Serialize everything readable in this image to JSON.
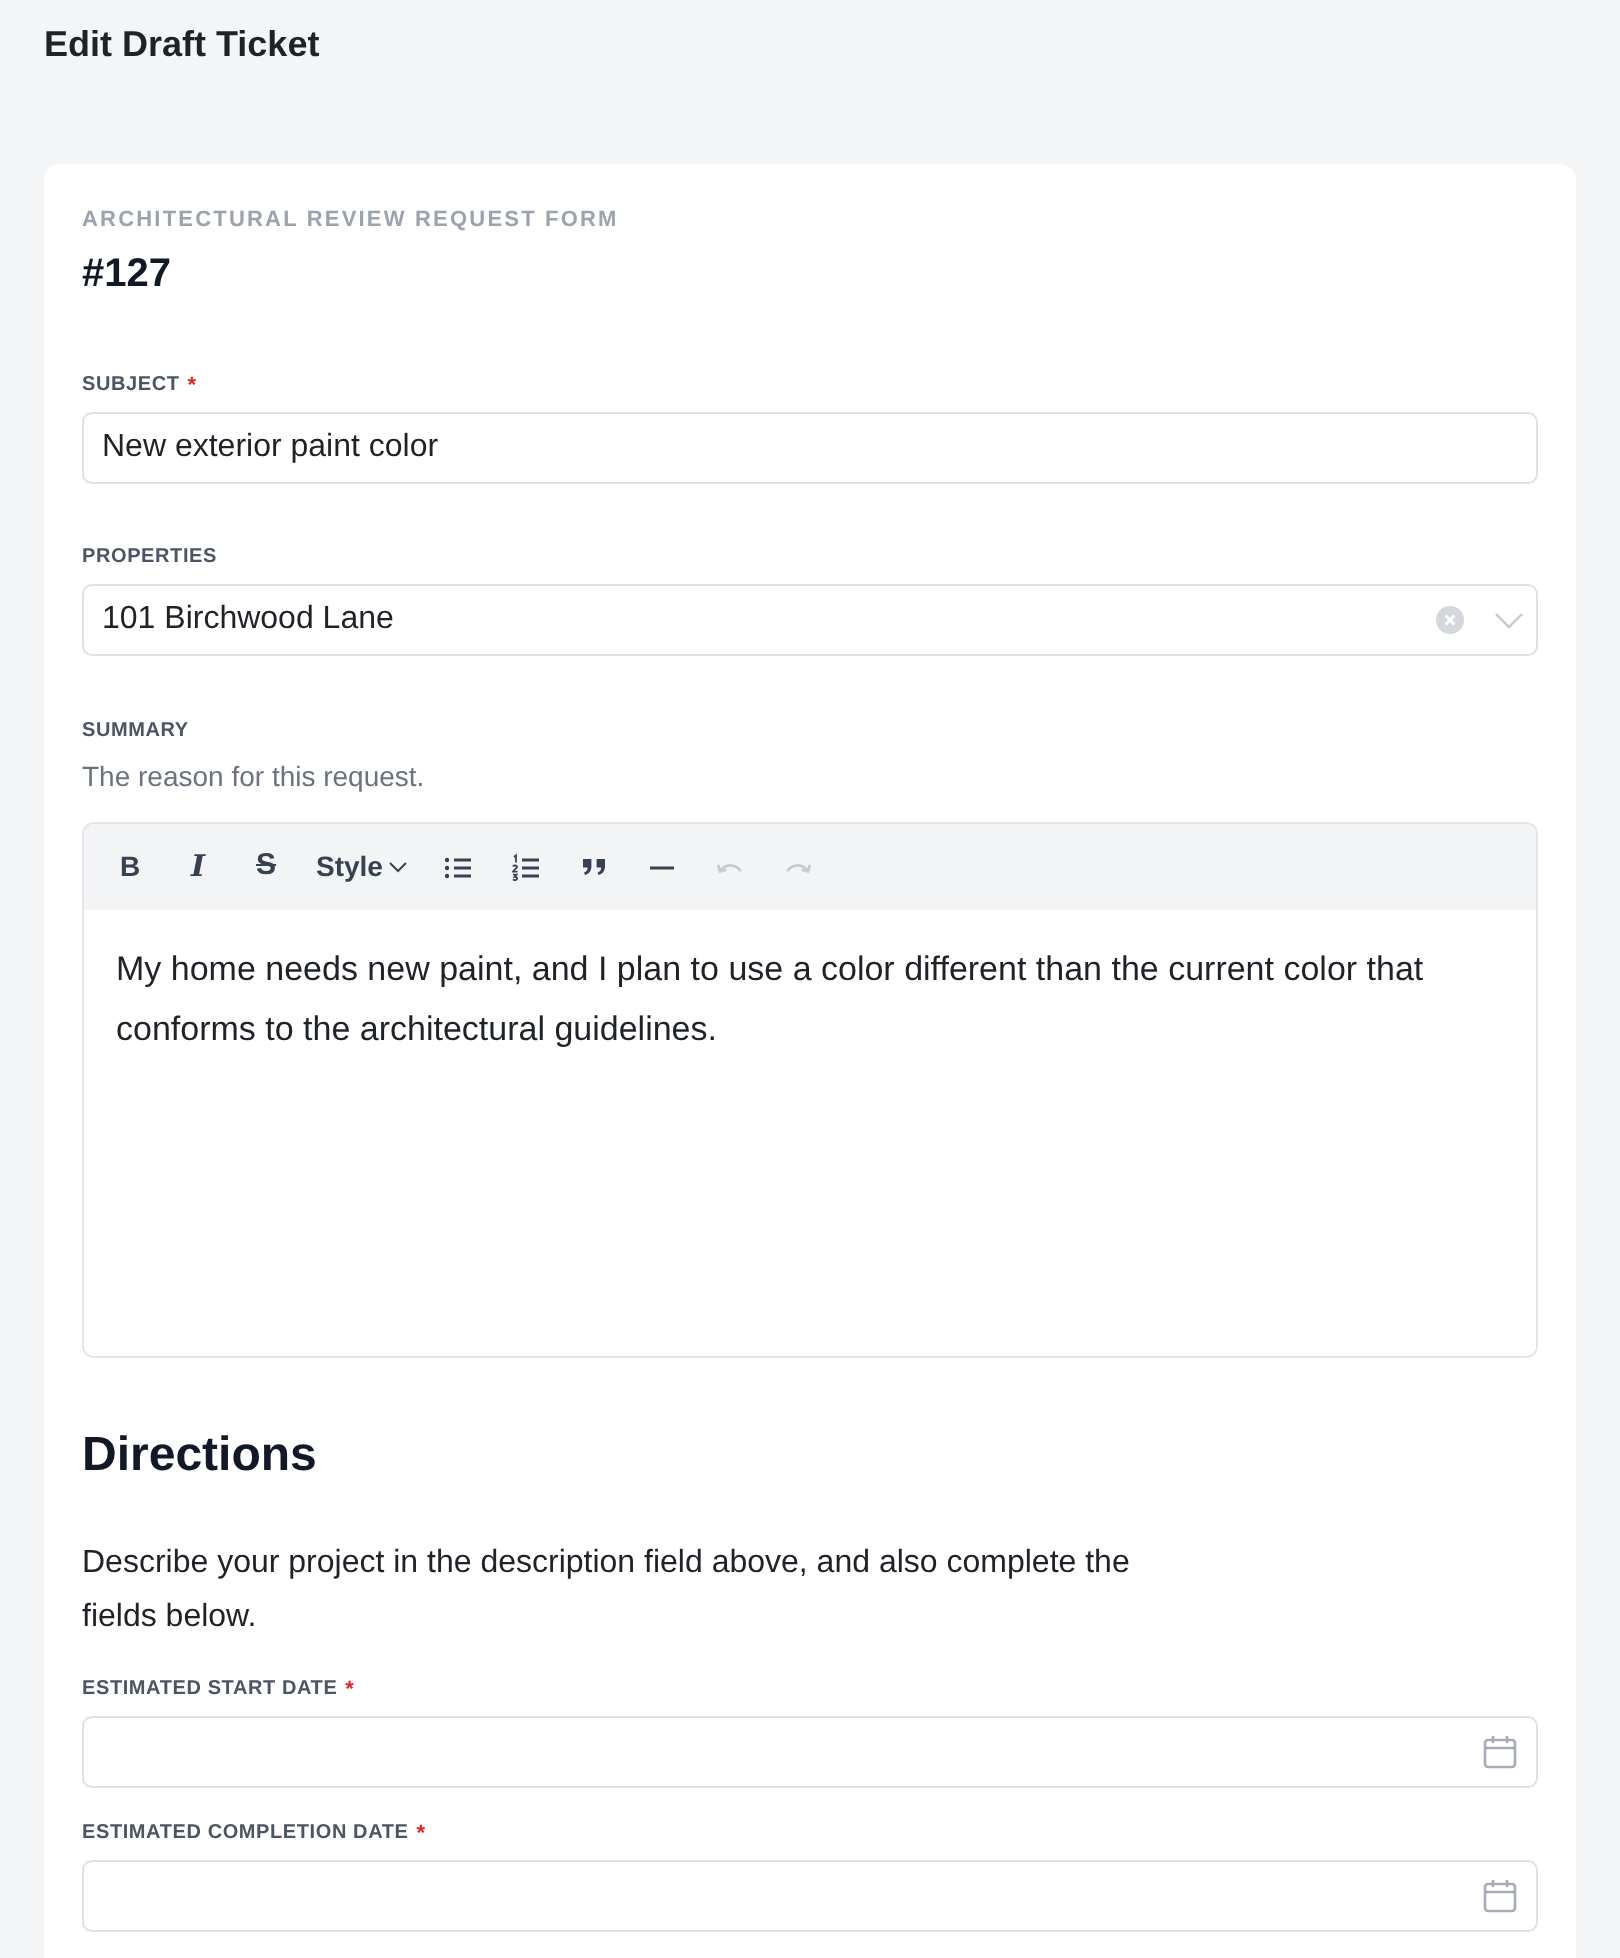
{
  "page": {
    "title": "Edit Draft Ticket"
  },
  "form": {
    "eyebrow": "ARCHITECTURAL REVIEW REQUEST FORM",
    "number": "#127",
    "fields": [
      {
        "kind": "text",
        "label": "SUBJECT",
        "required_mark": "*",
        "value": "New exterior paint color"
      },
      {
        "kind": "select",
        "label": "PROPERTIES",
        "value": "101 Birchwood Lane"
      },
      {
        "kind": "richtext",
        "label": "SUMMARY",
        "hint": "The reason for this request.",
        "toolbar": [
          {
            "kind": "bold",
            "label": "B",
            "disabled": false
          },
          {
            "kind": "italic",
            "label": "I",
            "disabled": false
          },
          {
            "kind": "strike",
            "label": "S",
            "disabled": false
          },
          {
            "kind": "style",
            "label": "Style",
            "disabled": false
          },
          {
            "kind": "bullet_list",
            "disabled": false
          },
          {
            "kind": "numbered_list",
            "disabled": false
          },
          {
            "kind": "quote",
            "disabled": false
          },
          {
            "kind": "rule",
            "disabled": false
          },
          {
            "kind": "undo",
            "disabled": true
          },
          {
            "kind": "redo",
            "disabled": true
          }
        ],
        "value": "My home needs new paint, and I plan to use a color different than the current color that conforms to the architectural guidelines."
      },
      {
        "kind": "heading",
        "text": "Directions"
      },
      {
        "kind": "paragraph",
        "text": "Describe your project in the description field above, and also complete the fields below."
      },
      {
        "kind": "date",
        "label": "ESTIMATED START DATE",
        "required_mark": "*"
      },
      {
        "kind": "date",
        "label": "ESTIMATED COMPLETION DATE",
        "required_mark": "*"
      }
    ]
  }
}
